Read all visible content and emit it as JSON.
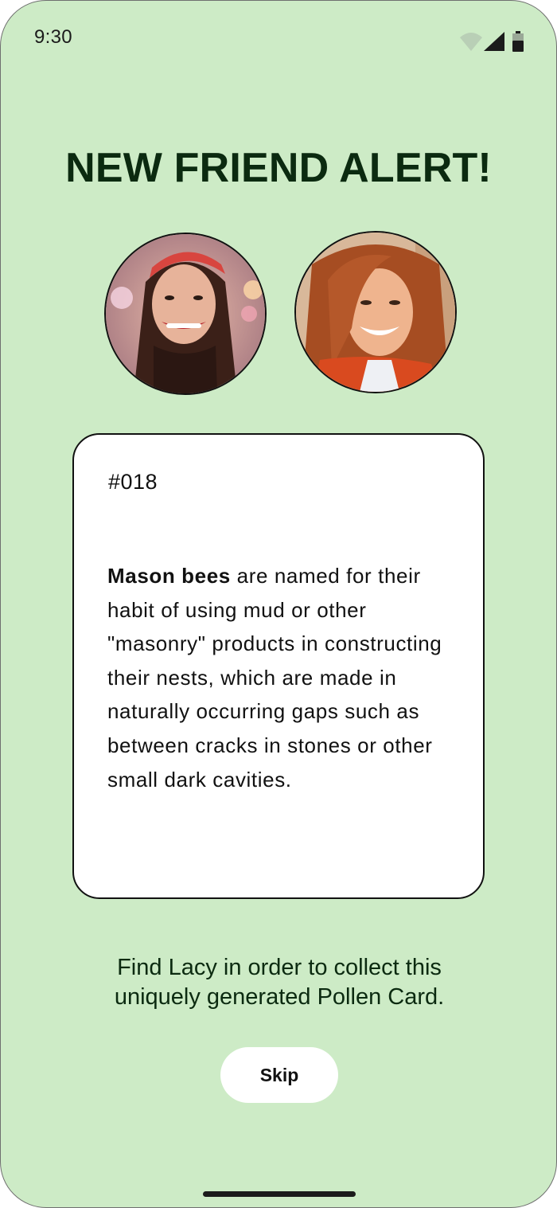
{
  "status_bar": {
    "time": "9:30",
    "icons": [
      "wifi-icon",
      "cellular-signal-icon",
      "battery-icon"
    ]
  },
  "headline": "NEW FRIEND ALERT!",
  "avatars": [
    {
      "description": "user-photo"
    },
    {
      "description": "friend-photo"
    }
  ],
  "card": {
    "number": "#018",
    "subject": "Mason bees",
    "body": " are named for their habit of using mud or other \"masonry\" products in constructing their nests, which are made in naturally occurring gaps such as between cracks in stones or other small dark cavities."
  },
  "instructions": "Find Lacy in order to collect this uniquely generated Pollen Card.",
  "skip_label": "Skip",
  "colors": {
    "background": "#cdebc6",
    "headline": "#0b2a10",
    "card": "#ffffff",
    "button": "#ffffff"
  }
}
